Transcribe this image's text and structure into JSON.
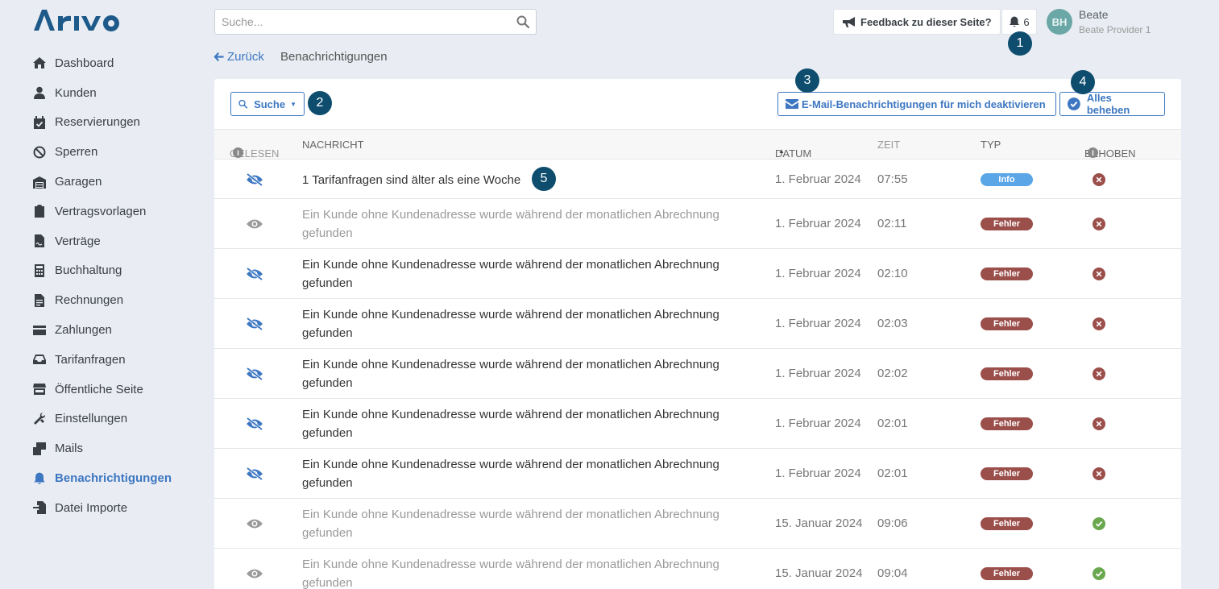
{
  "app": {
    "logo_text": "ARIVO",
    "accent": "#3d77c2"
  },
  "sidebar": {
    "items": [
      {
        "label": "Dashboard",
        "icon": "home-icon"
      },
      {
        "label": "Kunden",
        "icon": "user-icon"
      },
      {
        "label": "Reservierungen",
        "icon": "calendar-check-icon"
      },
      {
        "label": "Sperren",
        "icon": "ban-icon"
      },
      {
        "label": "Garagen",
        "icon": "warehouse-icon"
      },
      {
        "label": "Vertragsvorlagen",
        "icon": "clipboard-icon"
      },
      {
        "label": "Verträge",
        "icon": "file-contract-icon"
      },
      {
        "label": "Buchhaltung",
        "icon": "calculator-icon"
      },
      {
        "label": "Rechnungen",
        "icon": "invoice-icon"
      },
      {
        "label": "Zahlungen",
        "icon": "credit-card-icon"
      },
      {
        "label": "Tarifanfragen",
        "icon": "inbox-icon"
      },
      {
        "label": "Öffentliche Seite",
        "icon": "store-icon"
      },
      {
        "label": "Einstellungen",
        "icon": "tools-icon"
      },
      {
        "label": "Mails",
        "icon": "mail-bulk-icon"
      },
      {
        "label": "Benachrichtigungen",
        "icon": "bell-icon",
        "active": true
      },
      {
        "label": "Datei Importe",
        "icon": "file-import-icon"
      }
    ]
  },
  "topbar": {
    "search_placeholder": "Suche...",
    "feedback_label": "Feedback zu dieser Seite?",
    "notification_count": "6",
    "user_initials": "BH",
    "user_name": "Beate",
    "user_sub": "Beate Provider 1"
  },
  "breadcrumb": {
    "back_label": "Zurück",
    "current": "Benachrichtigungen"
  },
  "callouts": [
    "1",
    "2",
    "3",
    "4",
    "5"
  ],
  "toolbar": {
    "search_label": "Suche",
    "email_label": "E-Mail-Benachrichtigungen für mich deaktivieren",
    "resolve_all_label": "Alles beheben"
  },
  "table": {
    "headers": {
      "read": "GELESEN",
      "message": "NACHRICHT",
      "date": "DATUM",
      "time": "ZEIT",
      "type": "TYP",
      "resolved": "BEHOBEN"
    },
    "rows": [
      {
        "read": false,
        "message": "1 Tarifanfragen sind älter als eine Woche",
        "date": "1. Februar 2024",
        "time": "07:55",
        "type": "Info",
        "resolved": false
      },
      {
        "read": true,
        "message": "Ein Kunde ohne Kundenadresse wurde während der monatlichen Abrechnung gefunden",
        "date": "1. Februar 2024",
        "time": "02:11",
        "type": "Fehler",
        "resolved": false
      },
      {
        "read": false,
        "message": "Ein Kunde ohne Kundenadresse wurde während der monatlichen Abrechnung gefunden",
        "date": "1. Februar 2024",
        "time": "02:10",
        "type": "Fehler",
        "resolved": false
      },
      {
        "read": false,
        "message": "Ein Kunde ohne Kundenadresse wurde während der monatlichen Abrechnung gefunden",
        "date": "1. Februar 2024",
        "time": "02:03",
        "type": "Fehler",
        "resolved": false
      },
      {
        "read": false,
        "message": "Ein Kunde ohne Kundenadresse wurde während der monatlichen Abrechnung gefunden",
        "date": "1. Februar 2024",
        "time": "02:02",
        "type": "Fehler",
        "resolved": false
      },
      {
        "read": false,
        "message": "Ein Kunde ohne Kundenadresse wurde während der monatlichen Abrechnung gefunden",
        "date": "1. Februar 2024",
        "time": "02:01",
        "type": "Fehler",
        "resolved": false
      },
      {
        "read": false,
        "message": "Ein Kunde ohne Kundenadresse wurde während der monatlichen Abrechnung gefunden",
        "date": "1. Februar 2024",
        "time": "02:01",
        "type": "Fehler",
        "resolved": false
      },
      {
        "read": true,
        "message": "Ein Kunde ohne Kundenadresse wurde während der monatlichen Abrechnung gefunden",
        "date": "15. Januar 2024",
        "time": "09:06",
        "type": "Fehler",
        "resolved": true
      },
      {
        "read": true,
        "message": "Ein Kunde ohne Kundenadresse wurde während der monatlichen Abrechnung gefunden",
        "date": "15. Januar 2024",
        "time": "09:04",
        "type": "Fehler",
        "resolved": true
      }
    ]
  }
}
